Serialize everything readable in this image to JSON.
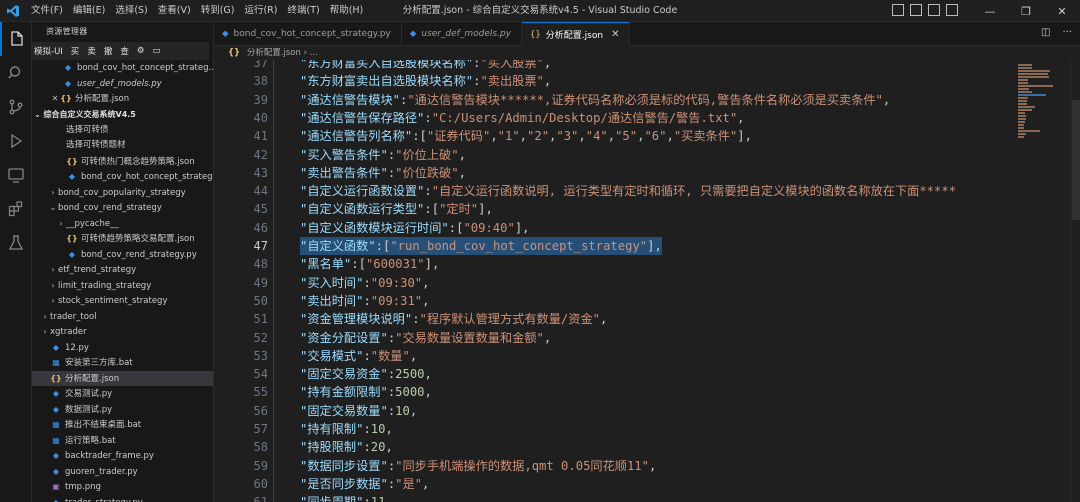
{
  "titlebar": {
    "menu": [
      "文件(F)",
      "编辑(E)",
      "选择(S)",
      "查看(V)",
      "转到(G)",
      "运行(R)",
      "终端(T)",
      "帮助(H)"
    ],
    "title": "分析配置.json - 综合自定义交易系统v4.5 - Visual Studio Code",
    "window_controls": [
      "—",
      "❐",
      "✕"
    ]
  },
  "sidebar": {
    "header": "资源管理器",
    "subbar": [
      "模拟-UI",
      "买",
      "卖",
      "撤",
      "查"
    ],
    "open_editors": [
      {
        "icon": "py",
        "label": "bond_cov_hot_concept_strateg...",
        "italic": false
      },
      {
        "icon": "py",
        "label": "user_def_models.py",
        "italic": true
      },
      {
        "icon": "json",
        "label": "分析配置.json",
        "italic": false,
        "close": "✕"
      }
    ],
    "section": "综合自定义交易系统V4.5",
    "tree": [
      {
        "indent": 2,
        "chev": "",
        "icon": "",
        "label": "选择可转债"
      },
      {
        "indent": 2,
        "chev": "",
        "icon": "",
        "label": "选择可转债题材"
      },
      {
        "indent": 2,
        "chev": "",
        "icon": "json",
        "label": "可转债热门概念趋势策略.json"
      },
      {
        "indent": 2,
        "chev": "",
        "icon": "py",
        "label": "bond_cov_hot_concept_strategy.py"
      },
      {
        "indent": 1,
        "chev": "›",
        "icon": "",
        "label": "bond_cov_popularity_strategy"
      },
      {
        "indent": 1,
        "chev": "⌄",
        "icon": "",
        "label": "bond_cov_rend_strategy"
      },
      {
        "indent": 2,
        "chev": "›",
        "icon": "",
        "label": "__pycache__"
      },
      {
        "indent": 2,
        "chev": "",
        "icon": "json",
        "label": "可转债趋势策略交易配置.json"
      },
      {
        "indent": 2,
        "chev": "",
        "icon": "py",
        "label": "bond_cov_rend_strategy.py"
      },
      {
        "indent": 1,
        "chev": "›",
        "icon": "",
        "label": "etf_trend_strategy"
      },
      {
        "indent": 1,
        "chev": "›",
        "icon": "",
        "label": "limit_trading_strategy"
      },
      {
        "indent": 1,
        "chev": "›",
        "icon": "",
        "label": "stock_sentiment_strategy"
      },
      {
        "indent": 0,
        "chev": "›",
        "icon": "",
        "label": "trader_tool"
      },
      {
        "indent": 0,
        "chev": "›",
        "icon": "",
        "label": "xgtrader"
      },
      {
        "indent": 0,
        "chev": "",
        "icon": "py",
        "label": "12.py"
      },
      {
        "indent": 0,
        "chev": "",
        "icon": "bat",
        "label": "安装第三方库.bat"
      },
      {
        "indent": 0,
        "chev": "",
        "icon": "json",
        "label": "分析配置.json",
        "selected": true
      },
      {
        "indent": 0,
        "chev": "",
        "icon": "py",
        "label": "交易测试.py"
      },
      {
        "indent": 0,
        "chev": "",
        "icon": "py",
        "label": "数据测试.py"
      },
      {
        "indent": 0,
        "chev": "",
        "icon": "bat",
        "label": "推出不结束桌面.bat"
      },
      {
        "indent": 0,
        "chev": "",
        "icon": "bat",
        "label": "运行策略.bat"
      },
      {
        "indent": 0,
        "chev": "",
        "icon": "py",
        "label": "backtrader_frame.py"
      },
      {
        "indent": 0,
        "chev": "",
        "icon": "py",
        "label": "guoren_trader.py"
      },
      {
        "indent": 0,
        "chev": "",
        "icon": "png",
        "label": "tmp.png"
      },
      {
        "indent": 0,
        "chev": "",
        "icon": "py",
        "label": "trader_strategy.py"
      }
    ]
  },
  "tabs": [
    {
      "icon": "py",
      "label": "bond_cov_hot_concept_strategy.py",
      "italic": false,
      "active": false
    },
    {
      "icon": "py",
      "label": "user_def_models.py",
      "italic": true,
      "active": false
    },
    {
      "icon": "json",
      "label": "分析配置.json",
      "italic": false,
      "active": true,
      "close": "✕"
    }
  ],
  "breadcrumb": {
    "icon_text": "{}",
    "file": "分析配置.json",
    "sep": "›",
    "more": "..."
  },
  "editor": {
    "current_line": 47,
    "lines": [
      {
        "n": 37,
        "t": [
          [
            "k",
            "\"东方财富买入自选股模块名称\""
          ],
          [
            "p",
            ":"
          ],
          [
            "s",
            "\"买入股票\""
          ],
          [
            "p",
            ","
          ]
        ]
      },
      {
        "n": 38,
        "t": [
          [
            "k",
            "\"东方财富卖出自选股模块名称\""
          ],
          [
            "p",
            ":"
          ],
          [
            "s",
            "\"卖出股票\""
          ],
          [
            "p",
            ","
          ]
        ]
      },
      {
        "n": 39,
        "t": [
          [
            "k",
            "\"通达信警告模块\""
          ],
          [
            "p",
            ":"
          ],
          [
            "s",
            "\"通达信警告模块******,证券代码名称必须是标的代码,警告条件名称必须是买卖条件\""
          ],
          [
            "p",
            ","
          ]
        ]
      },
      {
        "n": 40,
        "t": [
          [
            "k",
            "\"通达信警告保存路径\""
          ],
          [
            "p",
            ":"
          ],
          [
            "s",
            "\"C:/Users/Admin/Desktop/通达信警告/警告.txt\""
          ],
          [
            "p",
            ","
          ]
        ]
      },
      {
        "n": 41,
        "t": [
          [
            "k",
            "\"通达信警告列名称\""
          ],
          [
            "p",
            ":["
          ],
          [
            "s",
            "\"证券代码\""
          ],
          [
            "p",
            ","
          ],
          [
            "s",
            "\"1\""
          ],
          [
            "p",
            ","
          ],
          [
            "s",
            "\"2\""
          ],
          [
            "p",
            ","
          ],
          [
            "s",
            "\"3\""
          ],
          [
            "p",
            ","
          ],
          [
            "s",
            "\"4\""
          ],
          [
            "p",
            ","
          ],
          [
            "s",
            "\"5\""
          ],
          [
            "p",
            ","
          ],
          [
            "s",
            "\"6\""
          ],
          [
            "p",
            ","
          ],
          [
            "s",
            "\"买卖条件\""
          ],
          [
            "p",
            "],"
          ]
        ]
      },
      {
        "n": 42,
        "t": [
          [
            "k",
            "\"买入警告条件\""
          ],
          [
            "p",
            ":"
          ],
          [
            "s",
            "\"价位上破\""
          ],
          [
            "p",
            ","
          ]
        ]
      },
      {
        "n": 43,
        "t": [
          [
            "k",
            "\"卖出警告条件\""
          ],
          [
            "p",
            ":"
          ],
          [
            "s",
            "\"价位跌破\""
          ],
          [
            "p",
            ","
          ]
        ]
      },
      {
        "n": 44,
        "t": [
          [
            "k",
            "\"自定义运行函数设置\""
          ],
          [
            "p",
            ":"
          ],
          [
            "s",
            "\"自定义运行函数说明, 运行类型有定时和循环, 只需要把自定义模块的函数名称放在下面*****"
          ]
        ]
      },
      {
        "n": 45,
        "t": [
          [
            "k",
            "\"自定义函数运行类型\""
          ],
          [
            "p",
            ":["
          ],
          [
            "s",
            "\"定时\""
          ],
          [
            "p",
            "],"
          ]
        ]
      },
      {
        "n": 46,
        "t": [
          [
            "k",
            "\"自定义函数模块运行时间\""
          ],
          [
            "p",
            ":["
          ],
          [
            "s",
            "\"09:40\""
          ],
          [
            "p",
            "],"
          ]
        ]
      },
      {
        "n": 47,
        "t": [
          [
            "k",
            "\"自定义函数\""
          ],
          [
            "p",
            ":["
          ],
          [
            "s",
            "\"run_bond_cov_hot_concept_strategy\""
          ],
          [
            "p",
            "],"
          ]
        ]
      },
      {
        "n": 48,
        "t": [
          [
            "k",
            "\"黑名单\""
          ],
          [
            "p",
            ":["
          ],
          [
            "s",
            "\"600031\""
          ],
          [
            "p",
            "],"
          ]
        ]
      },
      {
        "n": 49,
        "t": [
          [
            "k",
            "\"买入时间\""
          ],
          [
            "p",
            ":"
          ],
          [
            "s",
            "\"09:30\""
          ],
          [
            "p",
            ","
          ]
        ]
      },
      {
        "n": 50,
        "t": [
          [
            "k",
            "\"卖出时间\""
          ],
          [
            "p",
            ":"
          ],
          [
            "s",
            "\"09:31\""
          ],
          [
            "p",
            ","
          ]
        ]
      },
      {
        "n": 51,
        "t": [
          [
            "k",
            "\"资金管理模块说明\""
          ],
          [
            "p",
            ":"
          ],
          [
            "s",
            "\"程序默认管理方式有数量/资金\""
          ],
          [
            "p",
            ","
          ]
        ]
      },
      {
        "n": 52,
        "t": [
          [
            "k",
            "\"资金分配设置\""
          ],
          [
            "p",
            ":"
          ],
          [
            "s",
            "\"交易数量设置数量和金额\""
          ],
          [
            "p",
            ","
          ]
        ]
      },
      {
        "n": 53,
        "t": [
          [
            "k",
            "\"交易模式\""
          ],
          [
            "p",
            ":"
          ],
          [
            "s",
            "\"数量\""
          ],
          [
            "p",
            ","
          ]
        ]
      },
      {
        "n": 54,
        "t": [
          [
            "k",
            "\"固定交易资金\""
          ],
          [
            "p",
            ":"
          ],
          [
            "n",
            "2500"
          ],
          [
            "p",
            ","
          ]
        ]
      },
      {
        "n": 55,
        "t": [
          [
            "k",
            "\"持有金额限制\""
          ],
          [
            "p",
            ":"
          ],
          [
            "n",
            "5000"
          ],
          [
            "p",
            ","
          ]
        ]
      },
      {
        "n": 56,
        "t": [
          [
            "k",
            "\"固定交易数量\""
          ],
          [
            "p",
            ":"
          ],
          [
            "n",
            "10"
          ],
          [
            "p",
            ","
          ]
        ]
      },
      {
        "n": 57,
        "t": [
          [
            "k",
            "\"持有限制\""
          ],
          [
            "p",
            ":"
          ],
          [
            "n",
            "10"
          ],
          [
            "p",
            ","
          ]
        ]
      },
      {
        "n": 58,
        "t": [
          [
            "k",
            "\"持股限制\""
          ],
          [
            "p",
            ":"
          ],
          [
            "n",
            "20"
          ],
          [
            "p",
            ","
          ]
        ]
      },
      {
        "n": 59,
        "t": [
          [
            "k",
            "\"数据同步设置\""
          ],
          [
            "p",
            ":"
          ],
          [
            "s",
            "\"同步手机端操作的数据,qmt 0.05同花顺11\""
          ],
          [
            "p",
            ","
          ]
        ]
      },
      {
        "n": 60,
        "t": [
          [
            "k",
            "\"是否同步数据\""
          ],
          [
            "p",
            ":"
          ],
          [
            "s",
            "\"是\""
          ],
          [
            "p",
            ","
          ]
        ]
      },
      {
        "n": 61,
        "t": [
          [
            "k",
            "\"同步周期\""
          ],
          [
            "p",
            ":"
          ],
          [
            "n",
            "11"
          ],
          [
            "p",
            ","
          ]
        ]
      }
    ]
  },
  "colors": {
    "accent": "#0078d4",
    "selection": "#264f78",
    "key": "#9cdcfe",
    "string": "#ce9178",
    "number": "#b5cea8"
  }
}
